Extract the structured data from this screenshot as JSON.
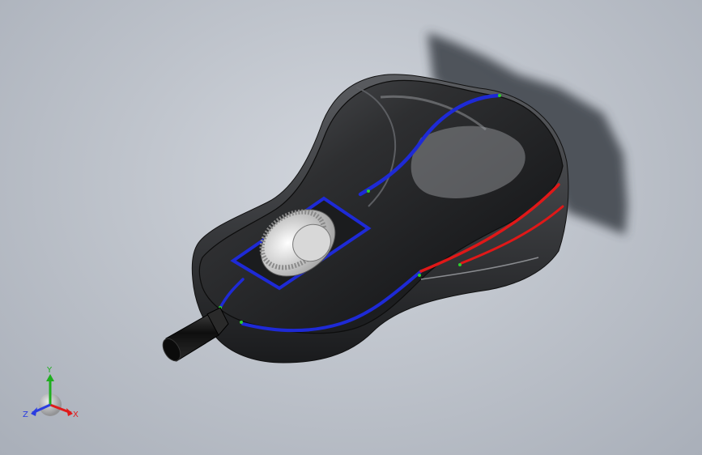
{
  "viewport": {
    "background_top": "#d2d6dd",
    "background_bottom": "#a9afb9"
  },
  "model": {
    "body_color": "#2e2f31",
    "highlight_color": "#8a8c90",
    "split_line_blue": "#1e2ad6",
    "split_line_red": "#e01818",
    "wheel_color": "#e8e8e8",
    "cable_color": "#151515",
    "shadow_color": "#3b3f46"
  },
  "triad": {
    "x_label": "X",
    "y_label": "Y",
    "z_label": "Z",
    "x_color": "#e01b1b",
    "y_color": "#1fae1f",
    "z_color": "#2b3de0"
  }
}
